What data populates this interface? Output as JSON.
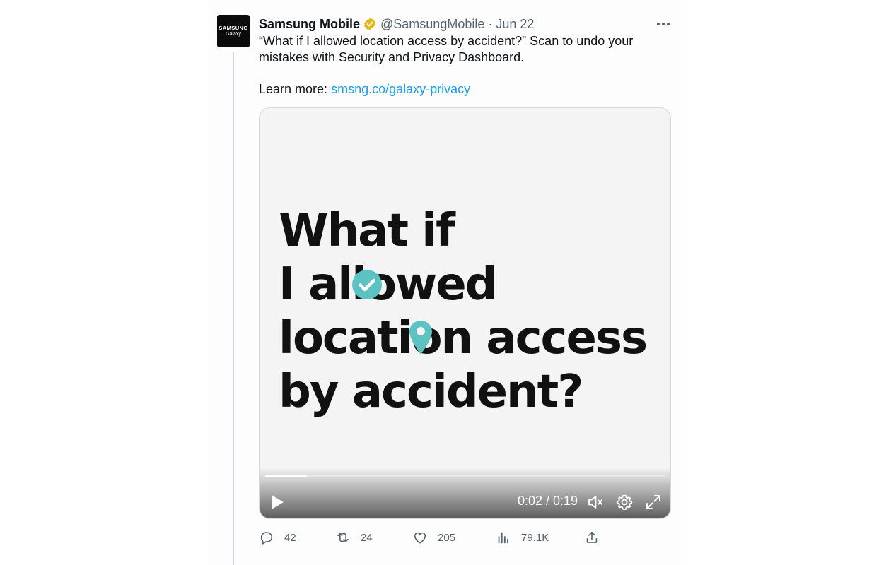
{
  "tweet": {
    "avatar": {
      "line1": "SAMSUNG",
      "line2": "Galaxy"
    },
    "display_name": "Samsung Mobile",
    "handle": "@SamsungMobile",
    "separator": "·",
    "date": "Jun 22",
    "text": "“What if I allowed location access by accident?” Scan to undo your mistakes with Security and Privacy Dashboard.",
    "learn_prefix": "Learn more:",
    "link_text": "smsng.co/galaxy-privacy"
  },
  "media": {
    "headline_lines": [
      "What if",
      "I allowed",
      "location access",
      "by accident?"
    ],
    "time": "0:02 / 0:19",
    "progress_fraction": 0.105,
    "accent_color": "#5cc2c2"
  },
  "actions": {
    "replies": "42",
    "retweets": "24",
    "likes": "205",
    "views": "79.1K"
  },
  "colors": {
    "link": "#1d9bf0",
    "secondary_text": "#536471",
    "verified": "#e2b719"
  },
  "icons": [
    "verified-badge-icon",
    "more-icon",
    "check-icon",
    "location-pin-icon",
    "play-icon",
    "mute-icon",
    "settings-icon",
    "fullscreen-icon",
    "reply-icon",
    "retweet-icon",
    "like-icon",
    "views-icon",
    "share-icon"
  ]
}
